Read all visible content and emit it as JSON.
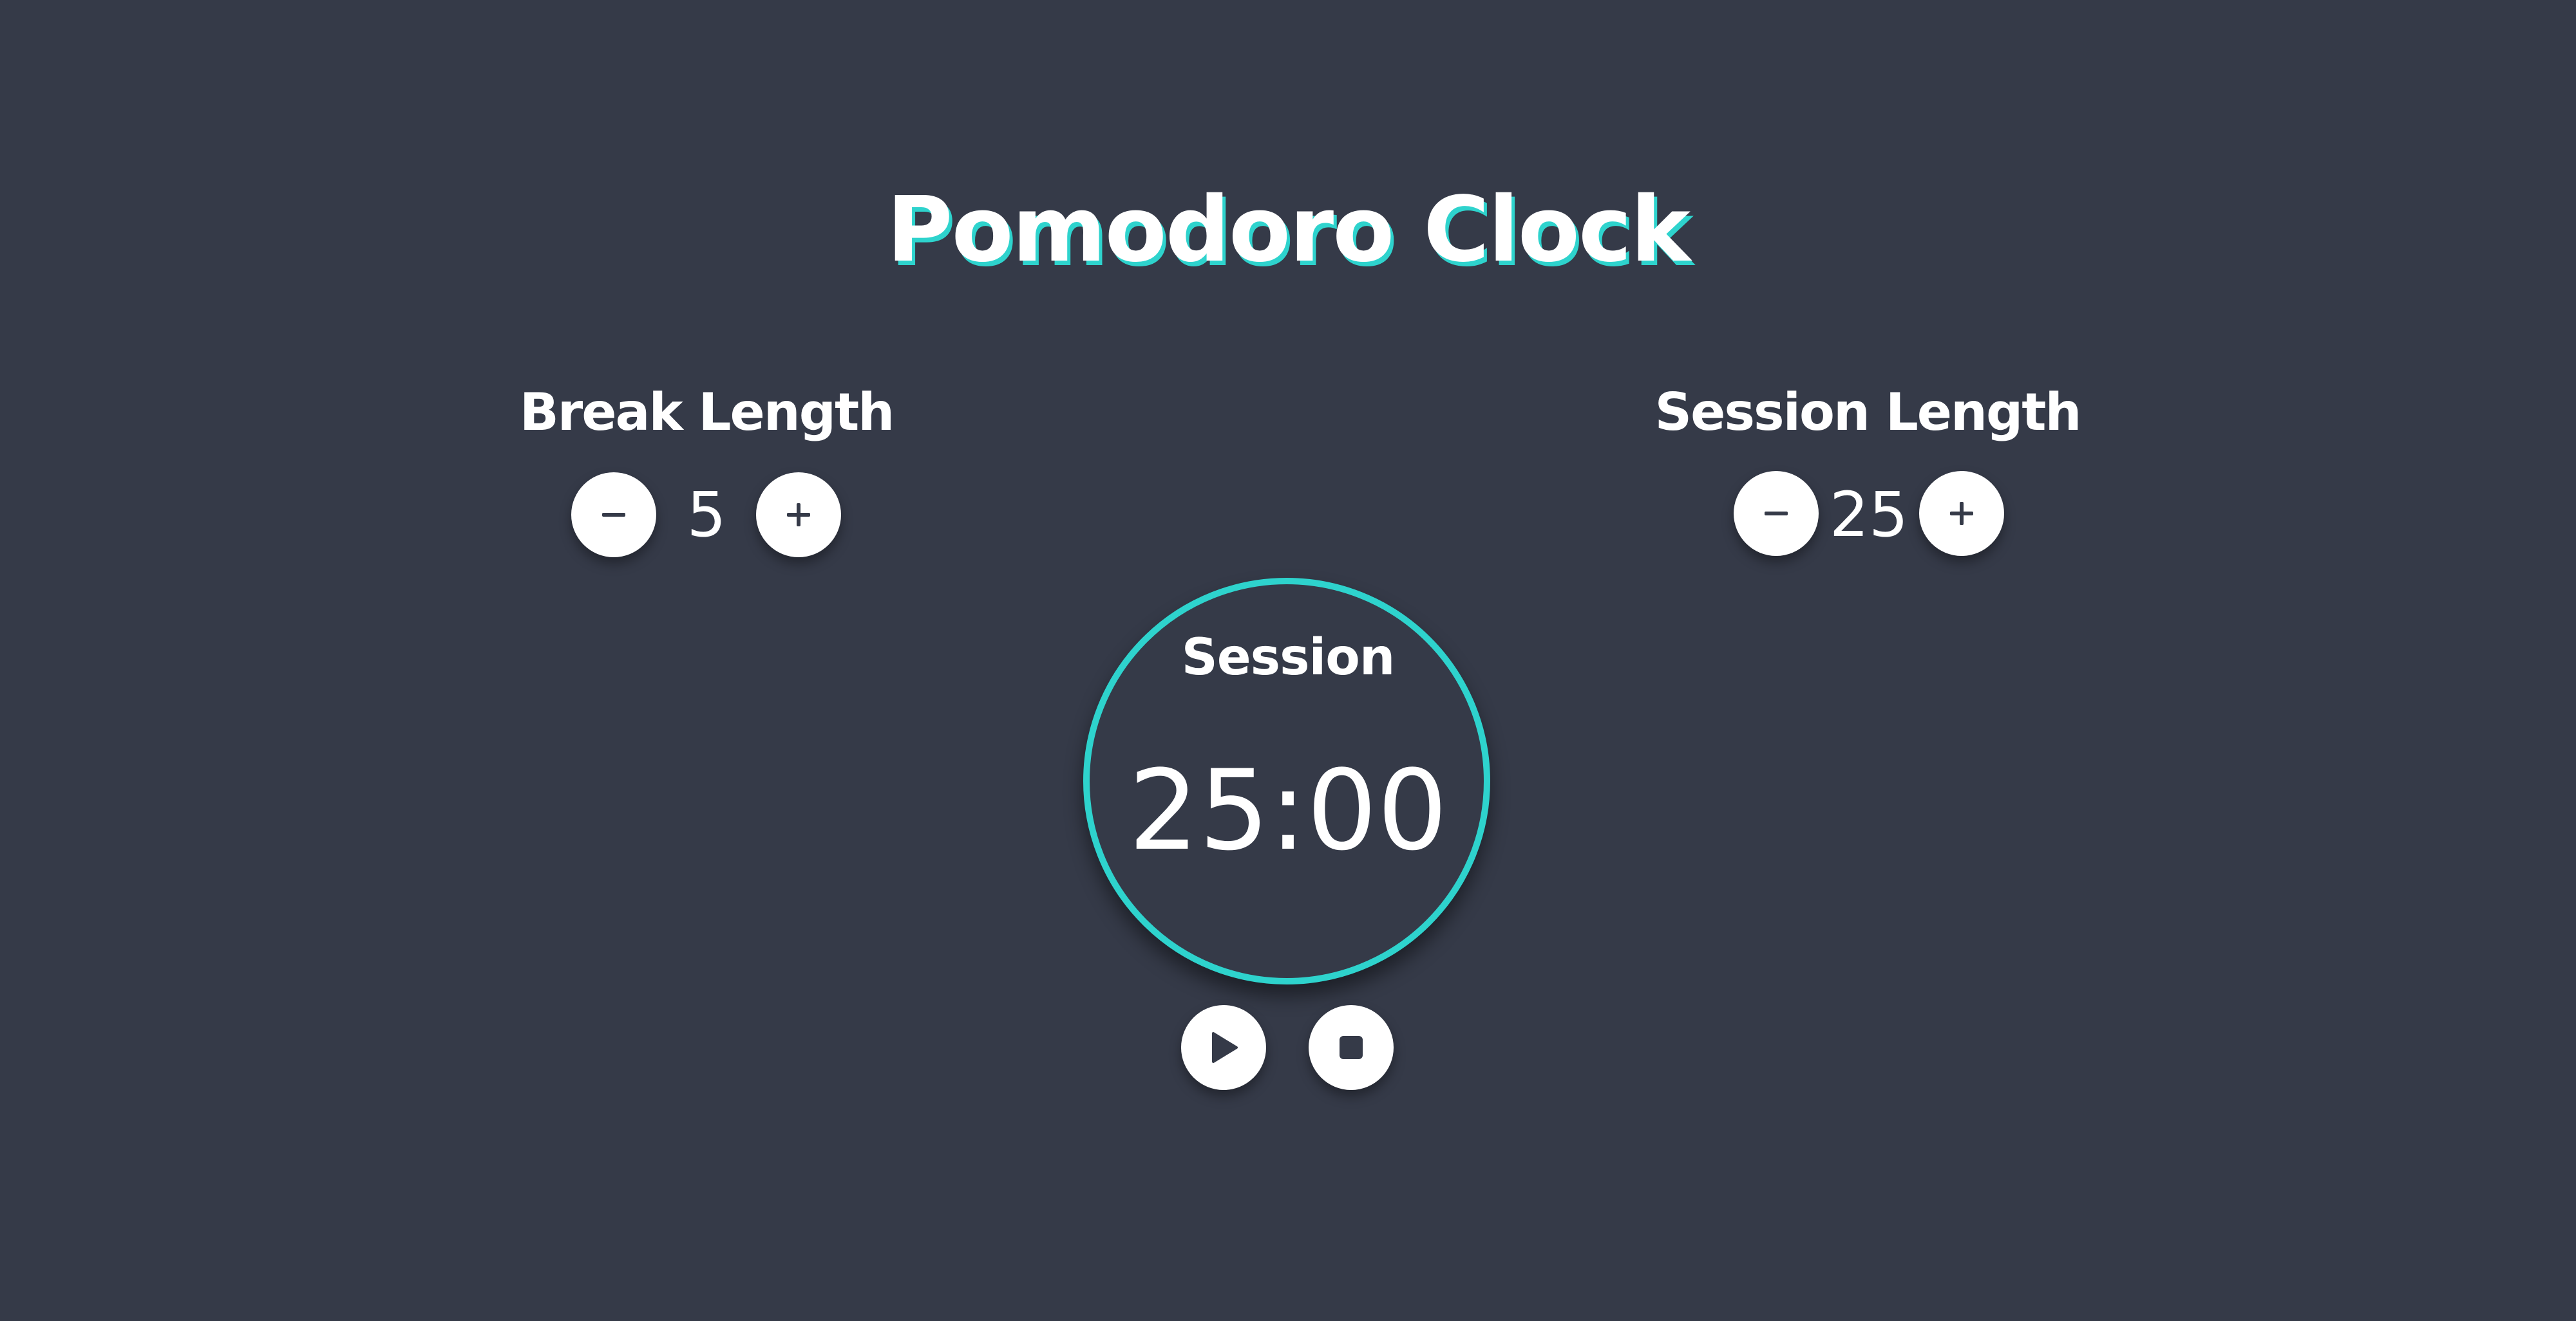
{
  "app": {
    "title": "Pomodoro Clock"
  },
  "break": {
    "label": "Break Length",
    "value": "5",
    "decrement_icon": "minus-icon",
    "increment_icon": "plus-icon"
  },
  "session": {
    "label": "Session Length",
    "value": "25",
    "decrement_icon": "minus-icon",
    "increment_icon": "plus-icon"
  },
  "timer": {
    "label": "Session",
    "time": "25:00",
    "ring_color": "#2ed3cd"
  },
  "controls": {
    "play_icon": "play-icon",
    "stop_icon": "stop-icon"
  },
  "theme": {
    "background": "#353a48",
    "accent": "#2ed3cd",
    "text": "#ffffff",
    "button_bg": "#ffffff",
    "icon_color": "#353a48"
  }
}
